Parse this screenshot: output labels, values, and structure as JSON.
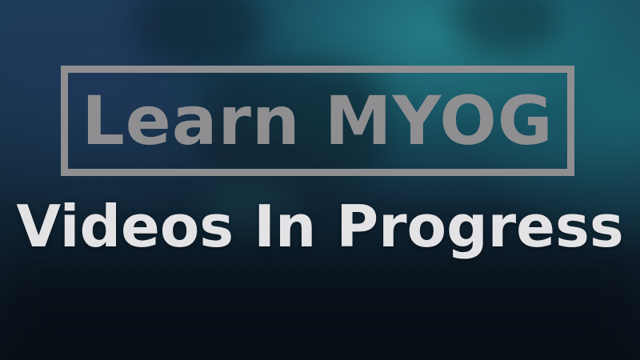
{
  "banner": {
    "title": "Learn MYOG",
    "subtitle": "Videos In Progress"
  },
  "colors": {
    "title_frame": "#8f8f91",
    "subtitle": "#e3e3e5",
    "background_top": "#1b3d58",
    "background_bottom": "#0a121a",
    "accent_glow": "#288c96"
  }
}
